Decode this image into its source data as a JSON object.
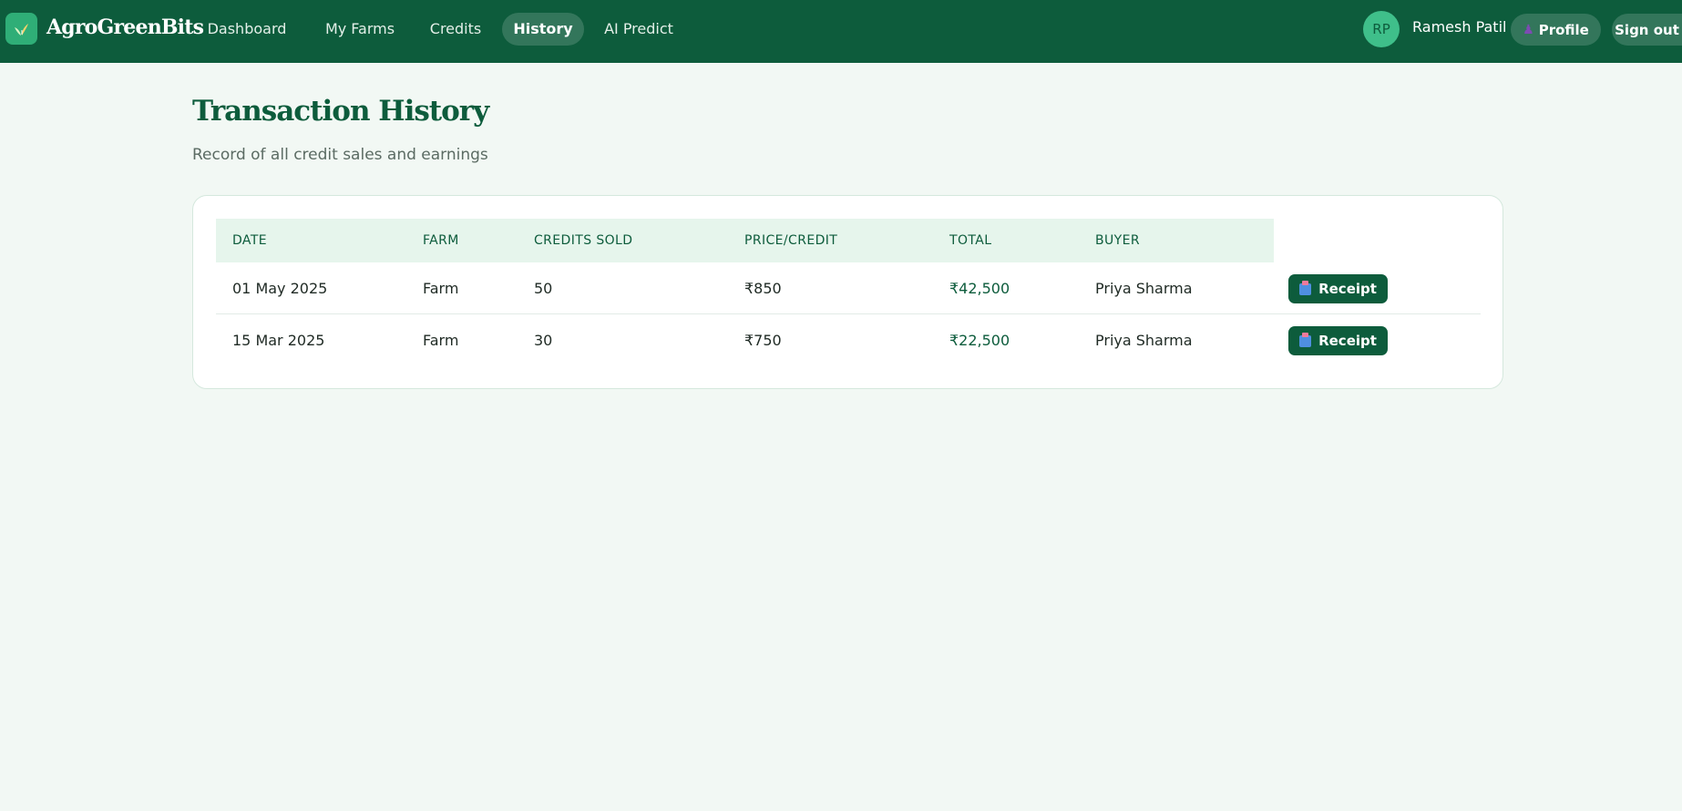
{
  "header": {
    "brand": "AgroGreenBits",
    "logo_icon": "leaf-icon",
    "nav": [
      {
        "label": "Dashboard",
        "active": false
      },
      {
        "label": "My Farms",
        "active": false
      },
      {
        "label": "Credits",
        "active": false
      },
      {
        "label": "History",
        "active": true
      },
      {
        "label": "AI Predict",
        "active": false
      }
    ],
    "user": {
      "initials": "RP",
      "name": "Ramesh Patil"
    },
    "profile_label": "Profile",
    "profile_icon": "person-icon",
    "signout_label": "Sign out"
  },
  "page": {
    "title": "Transaction History",
    "subtitle": "Record of all credit sales and earnings"
  },
  "table": {
    "columns": [
      "DATE",
      "FARM",
      "CREDITS SOLD",
      "PRICE/CREDIT",
      "TOTAL",
      "BUYER"
    ],
    "rows": [
      {
        "date": "01 May 2025",
        "farm": "Farm",
        "credits": "50",
        "price": "₹850",
        "total": "₹42,500",
        "buyer": "Priya Sharma",
        "action": "Receipt"
      },
      {
        "date": "15 Mar 2025",
        "farm": "Farm",
        "credits": "30",
        "price": "₹750",
        "total": "₹22,500",
        "buyer": "Priya Sharma",
        "action": "Receipt"
      }
    ],
    "receipt_icon": "receipt-icon"
  },
  "colors": {
    "brand": "#0d5c3c",
    "accent": "#3fbf8a",
    "background": "#f2f8f4",
    "table_header": "#e6f5ec"
  }
}
